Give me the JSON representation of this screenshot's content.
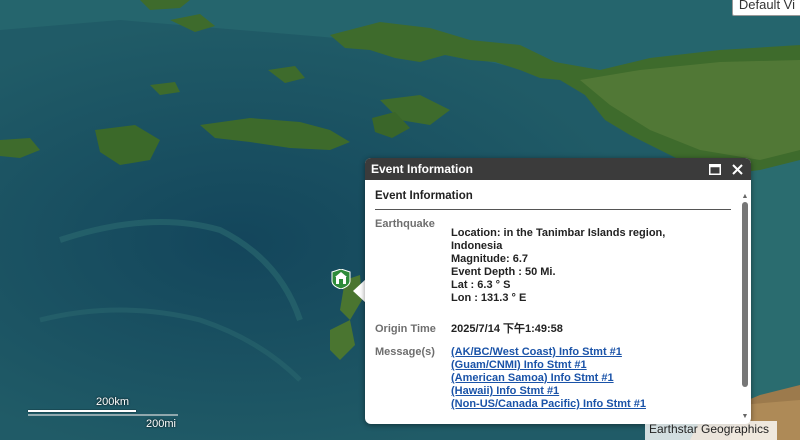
{
  "basemap_button": "Default Vi",
  "popup": {
    "header_title": "Event Information",
    "section_title": "Event Information",
    "earthquake_label": "Earthquake",
    "earthquake_lines": [
      "Location: in the Tanimbar Islands region,",
      "Indonesia",
      "Magnitude: 6.7",
      "Event Depth : 50 Mi.",
      "Lat : 6.3 ° S",
      "Lon : 131.3 ° E"
    ],
    "origin_label": "Origin Time",
    "origin_value": "2025/7/14 下午1:49:58",
    "messages_label": "Message(s)",
    "messages": [
      "(AK/BC/West Coast) Info Stmt #1",
      "(Guam/CNMI) Info Stmt #1",
      "(American Samoa) Info Stmt #1",
      "(Hawaii) Info Stmt #1",
      "(Non-US/Canada Pacific) Info Stmt #1"
    ]
  },
  "scale": {
    "km": "200km",
    "mi": "200mi"
  },
  "attribution": "Earthstar Geographics",
  "icons": [
    "maximize-icon",
    "close-icon",
    "earthquake-marker-icon"
  ],
  "colors": {
    "popup_header": "#3b3b3b",
    "link": "#1a53a8",
    "marker": "#2e8b3a"
  }
}
